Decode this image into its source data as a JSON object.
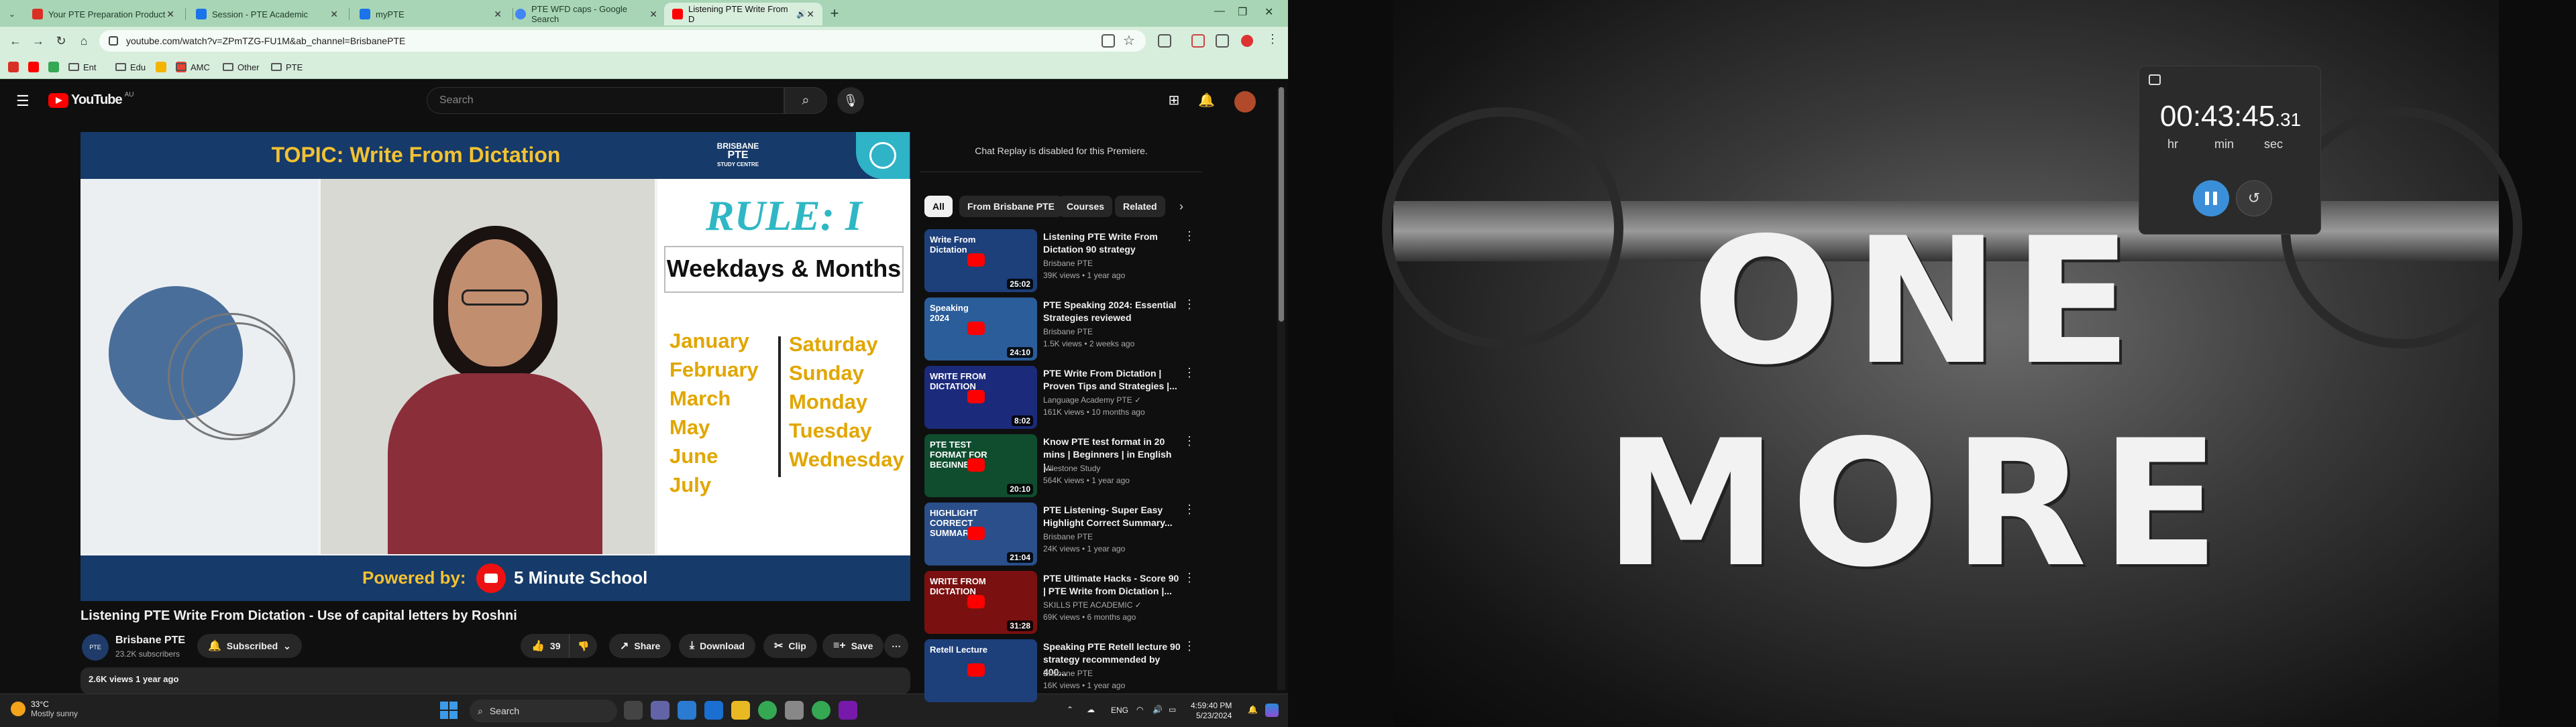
{
  "browser": {
    "tabs": [
      {
        "label": "Your PTE Preparation Product",
        "color": "#d93025"
      },
      {
        "label": "Session - PTE Academic",
        "color": "#1a73e8"
      },
      {
        "label": "myPTE",
        "color": "#1a73e8"
      },
      {
        "label": "PTE WFD caps - Google Search",
        "color": "#4285f4"
      },
      {
        "label": "Listening PTE Write From D",
        "color": "#ff0000"
      }
    ],
    "url": "youtube.com/watch?v=ZPmTZG-FU1M&ab_channel=BrisbanePTE",
    "bookmarks": [
      "Ent",
      "Edu",
      "AMC",
      "Other",
      "PTE"
    ]
  },
  "youtube": {
    "logo_text": "YouTube",
    "country_code": "AU",
    "search_placeholder": "Search",
    "video": {
      "top_banner": "TOPIC: Write From Dictation",
      "brand_line1": "BRISBANE",
      "brand_line2": "PTE",
      "brand_line3": "STUDY CENTRE",
      "rule": "RULE: I",
      "heading": "Weekdays & Months",
      "months": [
        "January",
        "February",
        "March",
        "May",
        "June",
        "July"
      ],
      "weekdays": [
        "Saturday",
        "Sunday",
        "Monday",
        "Tuesday",
        "Wednesday"
      ],
      "powered_by": "Powered by:",
      "powered_name": "5 Minute School"
    },
    "title": "Listening PTE Write From Dictation - Use of capital letters by Roshni",
    "channel": {
      "name": "Brisbane PTE",
      "subs": "23.2K subscribers",
      "avatar_text": "PTE"
    },
    "subscribed_label": "Subscribed",
    "likes": "39",
    "share_label": "Share",
    "download_label": "Download",
    "clip_label": "Clip",
    "save_label": "Save",
    "description": "2.6K views  1 year ago",
    "chat_replay": "Chat Replay is disabled for this Premiere.",
    "chips": [
      "All",
      "From Brisbane PTE",
      "Courses",
      "Related"
    ],
    "recommendations": [
      {
        "title": "Listening PTE Write From Dictation 90 strategy",
        "channel": "Brisbane PTE",
        "meta": "39K views • 1 year ago",
        "duration": "25:02",
        "thumb_text": "Write From Dictation",
        "thumb_color": "#1d3f7a"
      },
      {
        "title": "PTE Speaking 2024: Essential Strategies reviewed",
        "channel": "Brisbane PTE",
        "meta": "1.5K views • 2 weeks ago",
        "duration": "24:10",
        "thumb_text": "Speaking 2024",
        "thumb_color": "#2a5d9a"
      },
      {
        "title": "PTE Write From Dictation | Proven Tips and Strategies |...",
        "channel": "Language Academy PTE ✓",
        "meta": "161K views • 10 months ago",
        "duration": "8:02",
        "thumb_text": "WRITE FROM DICTATION",
        "thumb_color": "#1b2a7a"
      },
      {
        "title": "Know PTE test format in 20 mins | Beginners | in English |...",
        "channel": "Milestone Study",
        "meta": "564K views • 1 year ago",
        "duration": "20:10",
        "thumb_text": "PTE TEST FORMAT FOR BEGINNERS",
        "thumb_color": "#0f4d2e"
      },
      {
        "title": "PTE Listening- Super Easy Highlight Correct Summary...",
        "channel": "Brisbane PTE",
        "meta": "24K views • 1 year ago",
        "duration": "21:04",
        "thumb_text": "HIGHLIGHT CORRECT SUMMARY",
        "thumb_color": "#2a4f8a"
      },
      {
        "title": "PTE Ultimate Hacks - Score 90 | PTE Write from Dictation |...",
        "channel": "SKILLS PTE ACADEMIC ✓",
        "meta": "69K views • 6 months ago",
        "duration": "31:28",
        "thumb_text": "WRITE FROM DICTATION",
        "thumb_color": "#7a1010"
      },
      {
        "title": "Speaking PTE Retell lecture 90 strategy recommended by 400...",
        "channel": "Brisbane PTE",
        "meta": "16K views • 1 year ago",
        "duration": "",
        "thumb_text": "Retell Lecture",
        "thumb_color": "#1d3f7a"
      }
    ]
  },
  "taskbar": {
    "temp": "33°C",
    "condition": "Mostly sunny",
    "search": "Search",
    "lang": "ENG",
    "time": "4:59:40 PM",
    "date": "5/23/2024"
  },
  "timer": {
    "hours": "00",
    "minutes": "43",
    "seconds": "45",
    "fraction": ".31",
    "hr_label": "hr",
    "min_label": "min",
    "sec_label": "sec"
  },
  "wallpaper_text": "ONE MORE"
}
